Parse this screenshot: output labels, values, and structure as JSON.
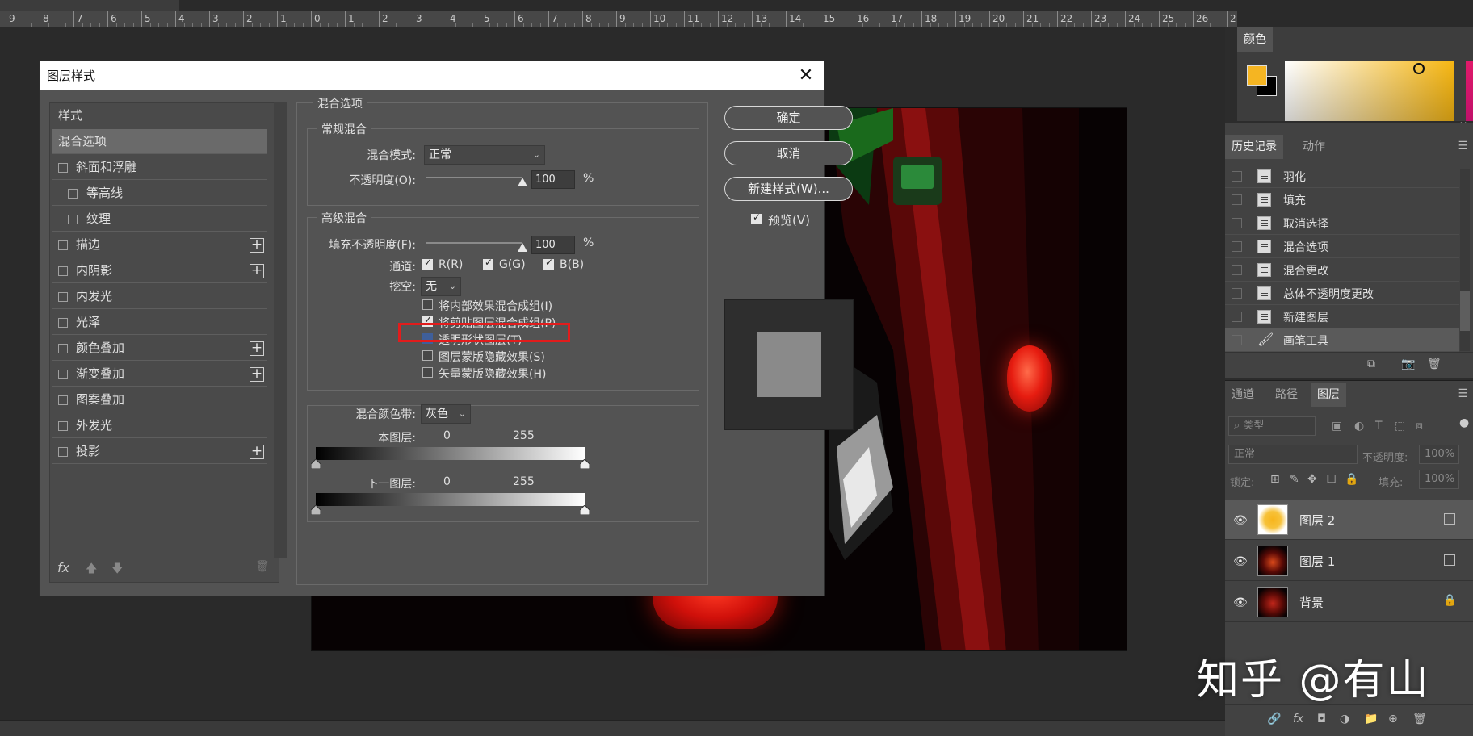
{
  "ruler": {
    "labels": [
      "9",
      "8",
      "7",
      "6",
      "5",
      "4",
      "3",
      "2",
      "1",
      "0",
      "1",
      "2",
      "3",
      "4",
      "5",
      "6",
      "7",
      "8",
      "9",
      "10",
      "11",
      "12",
      "13",
      "14",
      "15",
      "16",
      "17",
      "18",
      "19",
      "20",
      "21",
      "22",
      "23",
      "24",
      "25",
      "26",
      "2"
    ]
  },
  "dialog": {
    "title": "图层样式",
    "close": "✕",
    "style_list": {
      "header": "样式",
      "items": [
        {
          "label": "混合选项",
          "selected": true
        },
        {
          "label": "斜面和浮雕"
        },
        {
          "label": "等高线"
        },
        {
          "label": "纹理"
        },
        {
          "label": "描边"
        },
        {
          "label": "内阴影"
        },
        {
          "label": "内发光"
        },
        {
          "label": "光泽"
        },
        {
          "label": "颜色叠加"
        },
        {
          "label": "渐变叠加"
        },
        {
          "label": "图案叠加"
        },
        {
          "label": "外发光"
        },
        {
          "label": "投影"
        }
      ],
      "fx": "fx"
    },
    "blend": {
      "section_title": "混合选项",
      "general_title": "常规混合",
      "blend_mode_label": "混合模式:",
      "blend_mode_value": "正常",
      "opacity_label": "不透明度(O):",
      "opacity_value": "100",
      "percent": "%",
      "advanced_title": "高级混合",
      "fill_opacity_label": "填充不透明度(F):",
      "fill_opacity_value": "100",
      "channels_label": "通道:",
      "channel_r": "R(R)",
      "channel_g": "G(G)",
      "channel_b": "B(B)",
      "knockout_label": "挖空:",
      "knockout_value": "无",
      "opt1": "将内部效果混合成组(I)",
      "opt2": "将剪贴图层混合成组(P)",
      "opt3": "透明形状图层(T)",
      "opt4": "图层蒙版隐藏效果(S)",
      "opt5": "矢量蒙版隐藏效果(H)",
      "blend_if_label": "混合颜色带:",
      "blend_if_value": "灰色",
      "this_layer_label": "本图层:",
      "this_layer_min": "0",
      "this_layer_max": "255",
      "under_layer_label": "下一图层:",
      "under_layer_min": "0",
      "under_layer_max": "255"
    },
    "buttons": {
      "ok": "确定",
      "cancel": "取消",
      "new_style": "新建样式(W)...",
      "preview": "预览(V)"
    }
  },
  "color_panel": {
    "tab": "颜色",
    "foreground": "#f5b522",
    "background": "#000000"
  },
  "history_panel": {
    "tab_history": "历史记录",
    "tab_actions": "动作",
    "items": [
      "羽化",
      "填充",
      "取消选择",
      "混合选项",
      "混合更改",
      "总体不透明度更改",
      "新建图层",
      "画笔工具"
    ]
  },
  "layers_panel": {
    "tab_channels": "通道",
    "tab_paths": "路径",
    "tab_layers": "图层",
    "filter_placeholder": "类型",
    "blend_mode": "正常",
    "opacity_label": "不透明度:",
    "opacity_value": "100%",
    "lock_label": "锁定:",
    "fill_label": "填充:",
    "fill_value": "100%",
    "layers": [
      {
        "name": "图层 2"
      },
      {
        "name": "图层 1"
      },
      {
        "name": "背景"
      }
    ]
  },
  "watermark": "知乎 @有山"
}
